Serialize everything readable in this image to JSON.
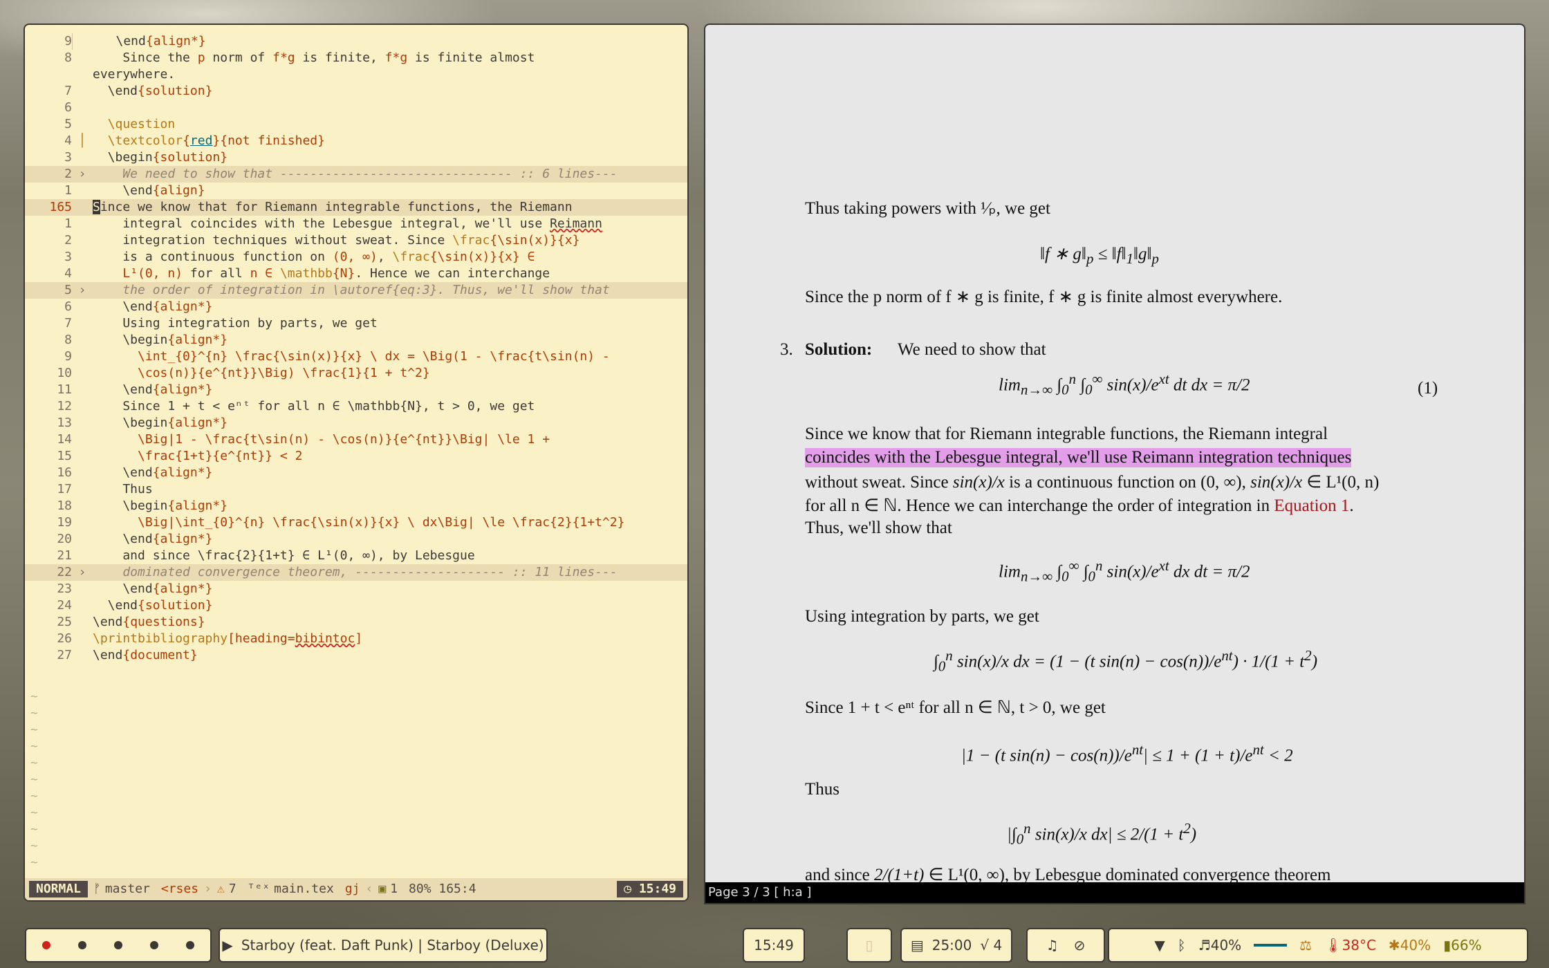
{
  "editor": {
    "lines": [
      {
        "n": "9",
        "t": "    \\end{align*}"
      },
      {
        "n": "8",
        "t": "    Since the p norm of f*g is finite, f*g is finite almost"
      },
      {
        "n": "",
        "t": "everywhere."
      },
      {
        "n": "7",
        "t": "  \\end{solution}"
      },
      {
        "n": "6",
        "t": ""
      },
      {
        "n": "5",
        "t": "  \\question"
      },
      {
        "n": "4",
        "t": "  \\textcolor{red}{not finished}"
      },
      {
        "n": "3",
        "t": "  \\begin{solution}"
      },
      {
        "n": "2",
        "t": "    We need to show that ------------------------------- :: 6 lines---"
      },
      {
        "n": "1",
        "t": "    \\end{align}"
      },
      {
        "n": "165",
        "t": "Since we know that for Riemann integrable functions, the Riemann"
      },
      {
        "n": "1",
        "t": "    integral coincides with the Lebesgue integral, we'll use Reimann"
      },
      {
        "n": "2",
        "t": "    integration techniques without sweat. Since \\frac{\\sin(x)}{x}"
      },
      {
        "n": "3",
        "t": "    is a continuous function on (0, ∞), \\frac{\\sin(x)}{x} ∈"
      },
      {
        "n": "4",
        "t": "    L¹(0, n) for all n ∈ \\mathbb{N}. Hence we can interchange"
      },
      {
        "n": "5",
        "t": "    the order of integration in \\autoref{eq:3}. Thus, we'll show that"
      },
      {
        "n": "6",
        "t": "    \\end{align*}"
      },
      {
        "n": "7",
        "t": "    Using integration by parts, we get"
      },
      {
        "n": "8",
        "t": "    \\begin{align*}"
      },
      {
        "n": "9",
        "t": "      \\int_{0}^{n} \\frac{\\sin(x)}{x} \\ dx = \\Big(1 - \\frac{t\\sin(n) -"
      },
      {
        "n": "10",
        "t": "      \\cos(n)}{e^{nt}}\\Big) \\frac{1}{1 + t^2}"
      },
      {
        "n": "11",
        "t": "    \\end{align*}"
      },
      {
        "n": "12",
        "t": "    Since 1 + t < eⁿᵗ for all n ∈ \\mathbb{N}, t > 0, we get"
      },
      {
        "n": "13",
        "t": "    \\begin{align*}"
      },
      {
        "n": "14",
        "t": "      \\Big|1 - \\frac{t\\sin(n) - \\cos(n)}{e^{nt}}\\Big| \\le 1 +"
      },
      {
        "n": "15",
        "t": "      \\frac{1+t}{e^{nt}} < 2"
      },
      {
        "n": "16",
        "t": "    \\end{align*}"
      },
      {
        "n": "17",
        "t": "    Thus"
      },
      {
        "n": "18",
        "t": "    \\begin{align*}"
      },
      {
        "n": "19",
        "t": "      \\Big|\\int_{0}^{n} \\frac{\\sin(x)}{x} \\ dx\\Big| \\le \\frac{2}{1+t^2}"
      },
      {
        "n": "20",
        "t": "    \\end{align*}"
      },
      {
        "n": "21",
        "t": "    and since \\frac{2}{1+t} ∈ L¹(0, ∞), by Lebesgue"
      },
      {
        "n": "22",
        "t": "    dominated convergence theorem, -------------------- :: 11 lines---"
      },
      {
        "n": "23",
        "t": "    \\end{align*}"
      },
      {
        "n": "24",
        "t": "  \\end{solution}"
      },
      {
        "n": "25",
        "t": "\\end{questions}"
      },
      {
        "n": "26",
        "t": "\\printbibliography[heading=bibintoc]"
      },
      {
        "n": "27",
        "t": "\\end{document}"
      }
    ],
    "status": {
      "mode": "NORMAL",
      "branch": "master",
      "context": "<rses",
      "warnings": "7",
      "filename": "main.tex",
      "keys": "gj",
      "count": "1",
      "position": "80% 165:4",
      "clock": "15:49"
    }
  },
  "viewer": {
    "status": "Page 3 / 3 [ h:a ]",
    "text": {
      "powers": "Thus taking powers with",
      "powers2": ", we get",
      "ineq": "‖f ∗ g‖",
      "pnorm": "Since the p norm of f ∗ g is finite, f ∗ g is finite almost everywhere.",
      "item": "3.",
      "solution": "Solution:",
      "need": "We need to show that",
      "eqnum": "(1)",
      "riemann1": "Since we know that for Riemann integrable functions, the Riemann integral",
      "riemann2": "coincides with the Lebesgue integral, we'll use Reimann integration techniques",
      "riemann3a": "without sweat. Since",
      "riemann3b": "is a continuous function on (0, ∞),",
      "riemann3c": "∈ L¹(0, n)",
      "riemann4a": "for all n ∈ ℕ. Hence we can interchange the order of integration in",
      "eqref": "Equation 1",
      "riemann5": "Thus, we'll show that",
      "byparts": "Using integration by parts, we get",
      "since": "Since 1 + t < eⁿᵗ for all n ∈ ℕ, t > 0, we get",
      "thus": "Thus",
      "andsince": "and since",
      "andsince2": "∈ L¹(0, ∞), by Lebesgue dominated convergence theorem"
    }
  },
  "taskbar": {
    "media": "Starboy (feat. Daft Punk) | Starboy (Deluxe)",
    "clock": "15:49",
    "pomodoro": "25:00",
    "tasks": "√ 4",
    "volume": "40%",
    "temp": "38°C",
    "cpu": "40%",
    "battery": "66%"
  }
}
